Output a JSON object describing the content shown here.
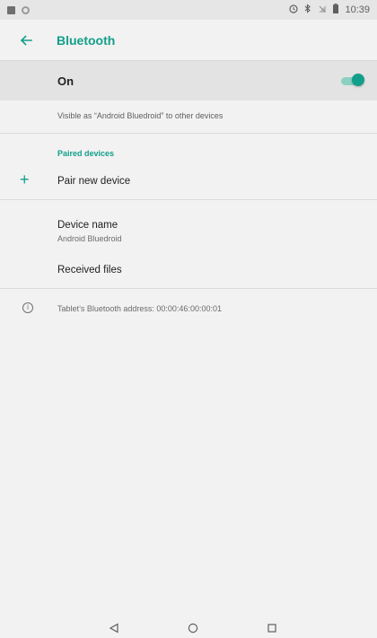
{
  "status_bar": {
    "time": "10:39",
    "left_icons": [
      "notification-image-icon",
      "notification-circle-icon"
    ],
    "right_icons": [
      "alarm-icon",
      "bluetooth-icon",
      "signal-off-icon",
      "battery-icon"
    ]
  },
  "app_bar": {
    "back_icon": "arrow-left-icon",
    "title": "Bluetooth"
  },
  "bluetooth_toggle": {
    "label": "On",
    "state": true,
    "accent_color": "#129f8a"
  },
  "visibility_text": "Visible as “Android Bluedroid” to other devices",
  "paired_devices": {
    "header": "Paired devices",
    "pair_new": "Pair new device"
  },
  "device_name": {
    "title": "Device name",
    "value": "Android Bluedroid"
  },
  "received_files": "Received files",
  "address_info": "Tablet’s Bluetooth address: 00:00:46:00:00:01",
  "nav_bar": {
    "icons": [
      "back-triangle-icon",
      "home-circle-icon",
      "recents-square-icon"
    ]
  }
}
